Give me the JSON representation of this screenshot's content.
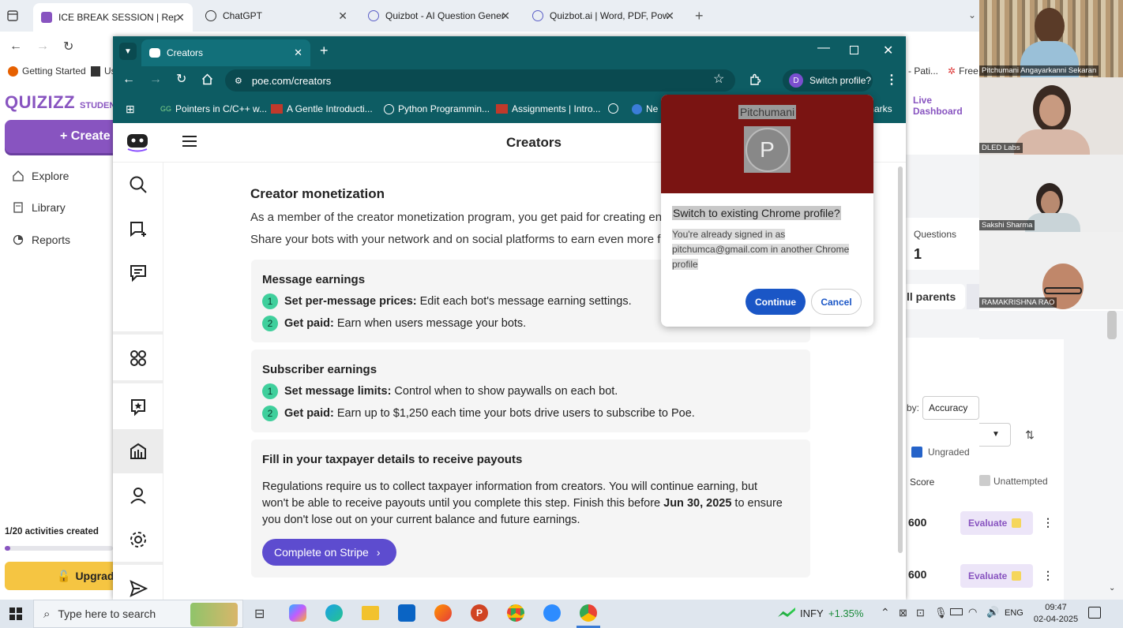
{
  "back_browser": {
    "tabs": [
      {
        "title": "ICE BREAK SESSION | Reports | Q",
        "active": true
      },
      {
        "title": "ChatGPT",
        "active": false
      },
      {
        "title": "Quizbot - AI Question Generato",
        "active": false
      },
      {
        "title": "Quizbot.ai | Word, PDF, PowerPo",
        "active": false
      }
    ],
    "bookmarks": [
      "Getting Started",
      "Us",
      "- Pati...",
      "Free"
    ],
    "live_dashboard": "Live Dashboard"
  },
  "quizizz": {
    "logo": "QUIZIZZ",
    "logo_suffix": "STUDENT",
    "create_label": "+ Create",
    "nav": [
      "Explore",
      "Library",
      "Reports"
    ],
    "activities": "1/20 activities created",
    "upgrade": "Upgrade",
    "activities_progress": 0.05
  },
  "popup_window": {
    "tab_title": "Creators",
    "url": "poe.com/creators",
    "switch_profile": "Switch profile?",
    "profile_initial": "D",
    "bookmarks": [
      "Pointers in C/C++ w...",
      "A Gentle Introducti...",
      "Python Programmin...",
      "Assignments | Intro...",
      "",
      "Ne"
    ],
    "bookmarks_tail": "marks"
  },
  "poe": {
    "header_title": "Creators",
    "section_title": "Creator monetization",
    "intro1": "As a member of the creator monetization program, you get paid for creating eng",
    "intro2": "Share your bots with your network and on social platforms to earn even more fri",
    "message_earnings": {
      "title": "Message earnings",
      "items": [
        {
          "n": "1",
          "bold": "Set per-message prices:",
          "text": "Edit each bot's message earning settings."
        },
        {
          "n": "2",
          "bold": "Get paid:",
          "text": "Earn when users message your bots."
        }
      ]
    },
    "subscriber_earnings": {
      "title": "Subscriber earnings",
      "items": [
        {
          "n": "1",
          "bold": "Set message limits:",
          "text": "Control when to show paywalls on each bot."
        },
        {
          "n": "2",
          "bold": "Get paid:",
          "text": "Earn up to $1,250 each time your bots drive users to subscribe to Poe."
        }
      ]
    },
    "taxpayer": {
      "title": "Fill in your taxpayer details to receive payouts",
      "line1": "Regulations require us to collect taxpayer information from creators. You will continue earning, but",
      "line2a": "won't be able to receive payouts until you complete this step. Finish this before ",
      "line2b": "Jun 30, 2025",
      "line2c": " to ensure",
      "line3": "you don't lose out on your current balance and future earnings.",
      "button": "Complete on Stripe"
    }
  },
  "profile_dialog": {
    "name": "Pitchumani",
    "avatar": "P",
    "heading": "Switch to existing Chrome profile?",
    "body1": "You're already signed in as",
    "body2": "pitchumca@gmail.com in another Chrome",
    "body3": "profile",
    "continue": "Continue",
    "cancel": "Cancel"
  },
  "report_panel": {
    "questions_label": "Questions",
    "questions_value": "1",
    "parents_tab": "ll parents",
    "sort_by": "by:",
    "sort_value": "Accuracy",
    "legend_ungraded": "Ungraded",
    "legend_unattempted": "Unattempted",
    "score_header": "Score",
    "rows": [
      {
        "score": "600",
        "action": "Evaluate"
      },
      {
        "score": "600",
        "action": "Evaluate"
      }
    ]
  },
  "video": [
    {
      "name": "Pitchumani Angayarkanni Sekaran"
    },
    {
      "name": "DLED Labs"
    },
    {
      "name": "Sakshi Sharma"
    },
    {
      "name": "RAMAKRISHNA RAO"
    }
  ],
  "taskbar": {
    "search": "Type here to search",
    "stock_name": "INFY",
    "stock_change": "+1.35%",
    "lang": "ENG",
    "time": "09:47",
    "date": "02-04-2025"
  },
  "colors": {
    "poe_teal": "#0d5c63",
    "quizizz_purple": "#8854c0",
    "stripe_button": "#5d4ccf",
    "continue_blue": "#1a56c6",
    "dialog_header": "#7a1412"
  }
}
